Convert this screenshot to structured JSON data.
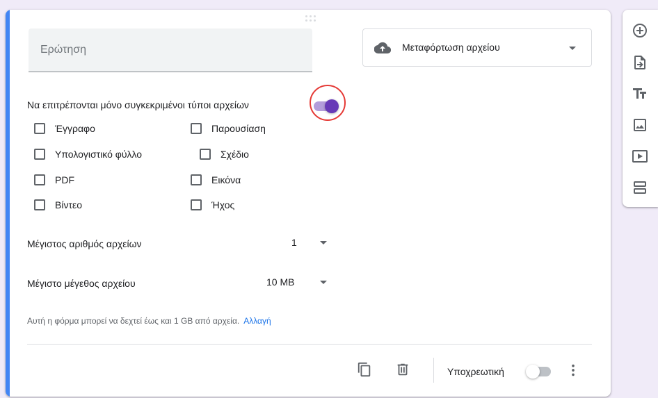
{
  "question": {
    "placeholder": "Ερώτηση"
  },
  "type_select": {
    "icon": "cloud-upload-icon",
    "label": "Μεταφόρτωση αρχείου"
  },
  "restrict_types": {
    "label": "Να επιτρέπονται μόνο συγκεκριμένοι τύποι αρχείων",
    "enabled": true
  },
  "file_types": [
    {
      "label": "Έγγραφο",
      "checked": false
    },
    {
      "label": "Παρουσίαση",
      "checked": false
    },
    {
      "label": "Υπολογιστικό φύλλο",
      "checked": false
    },
    {
      "label": "Σχέδιο",
      "checked": false
    },
    {
      "label": "PDF",
      "checked": false
    },
    {
      "label": "Εικόνα",
      "checked": false
    },
    {
      "label": "Βίντεο",
      "checked": false
    },
    {
      "label": "Ήχος",
      "checked": false
    }
  ],
  "max_files": {
    "label": "Μέγιστος αριθμός αρχείων",
    "value": "1"
  },
  "max_size": {
    "label": "Μέγιστο μέγεθος αρχείου",
    "value": "10 MB"
  },
  "note": {
    "text": "Αυτή η φόρμα μπορεί να δεχτεί έως και 1 GB από αρχεία.",
    "link": "Αλλαγή"
  },
  "footer": {
    "required_label": "Υποχρεωτική",
    "required_enabled": false
  },
  "colors": {
    "accent": "#4285f4",
    "toggle_on": "#673ab7",
    "highlight": "#e53935",
    "link": "#1a73e8"
  },
  "sidebar_icons": [
    "add-question-icon",
    "import-questions-icon",
    "add-title-icon",
    "add-image-icon",
    "add-video-icon",
    "add-section-icon"
  ]
}
